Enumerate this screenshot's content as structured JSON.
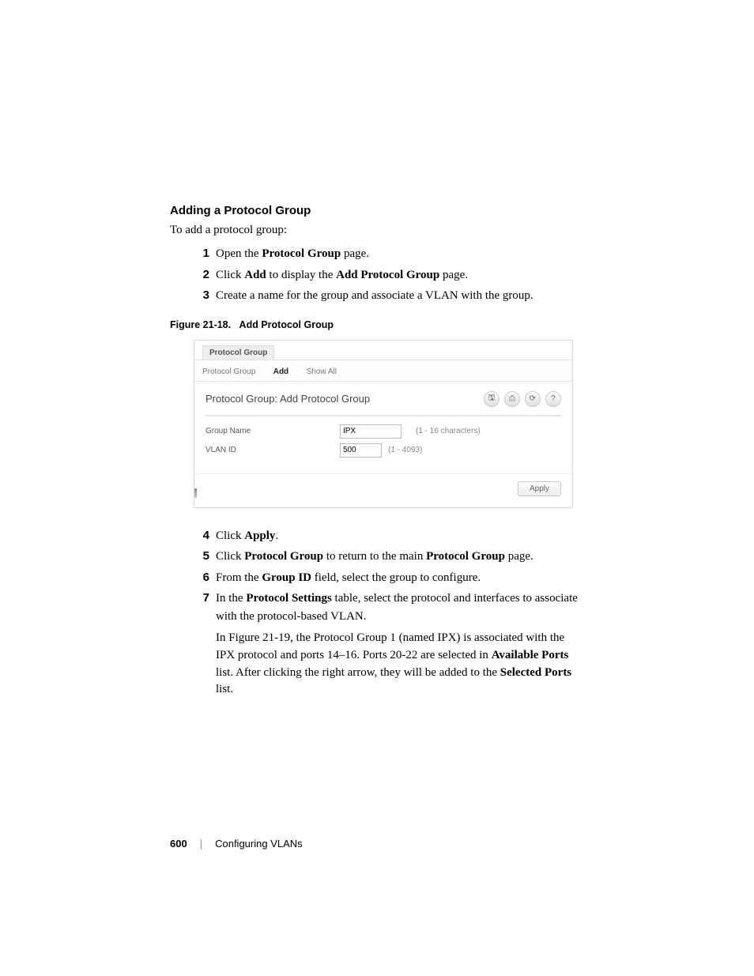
{
  "heading": "Adding a Protocol Group",
  "intro": "To add a protocol group:",
  "steps_top": [
    {
      "num": "1",
      "before": "Open the ",
      "bold1": "Protocol Group",
      "after": " page."
    },
    {
      "num": "2",
      "before": "Click ",
      "bold1": "Add",
      "mid": " to display the ",
      "bold2": "Add Protocol Group",
      "after": " page."
    },
    {
      "num": "3",
      "before": "Create a name for the group and associate a VLAN with the group.",
      "bold1": "",
      "after": ""
    }
  ],
  "figure_caption_prefix": "Figure 21-18.",
  "figure_caption_title": "Add Protocol Group",
  "screenshot": {
    "window_tab": "Protocol Group",
    "tabs": [
      "Protocol Group",
      "Add",
      "Show All"
    ],
    "active_tab": "Add",
    "panel_title": "Protocol Group: Add Protocol Group",
    "icons": [
      "save-icon",
      "print-icon",
      "refresh-icon",
      "help-icon"
    ],
    "icon_glyphs": {
      "save-icon": "🖫",
      "print-icon": "⎙",
      "refresh-icon": "⟳",
      "help-icon": "?"
    },
    "row1_label": "Group Name",
    "row1_value": "IPX",
    "row1_hint": "(1 - 16 characters)",
    "row2_label": "VLAN ID",
    "row2_value": "500",
    "row2_hint": "(1 - 4093)",
    "apply": "Apply"
  },
  "steps_bottom": [
    {
      "num": "4",
      "html": "Click <b>Apply</b>."
    },
    {
      "num": "5",
      "html": "Click <b>Protocol Group</b> to return to the main <b>Protocol Group</b> page."
    },
    {
      "num": "6",
      "html": "From the <b>Group ID</b> field, select the group to configure."
    },
    {
      "num": "7",
      "html": "In the <b>Protocol Settings</b> table, select the protocol and interfaces to associate with the protocol-based VLAN.",
      "para": "In Figure 21-19, the Protocol Group 1 (named IPX) is associated with the IPX protocol and ports 14–16. Ports 20-22 are selected in <b>Available Ports</b> list. After clicking the right arrow, they will be added to the <b>Selected Ports</b> list."
    }
  ],
  "footer": {
    "page": "600",
    "section": "Configuring VLANs",
    "divider": "|"
  }
}
